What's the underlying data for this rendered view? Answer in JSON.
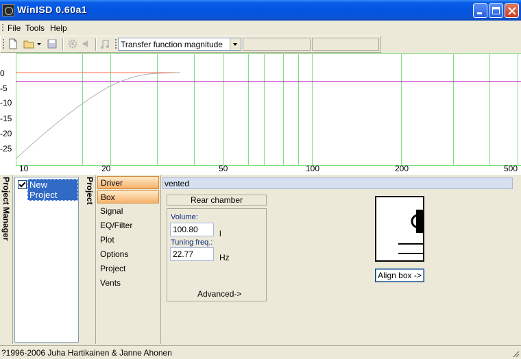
{
  "window": {
    "title": "WinISD 0.60a1"
  },
  "menu": {
    "items": [
      "File",
      "Tools",
      "Help"
    ]
  },
  "toolbar": {
    "icons": [
      "new-file-icon",
      "open-folder-icon",
      "dropdown-arrow-icon",
      "save-icon",
      "gear-icon",
      "speaker-icon",
      "music-note-icon"
    ],
    "plot_select": "Transfer function magnitude"
  },
  "graph": {
    "y_labels": [
      "0",
      "-5",
      "-10",
      "-15",
      "-20",
      "-25"
    ],
    "x_labels": [
      "10",
      "20",
      "50",
      "100",
      "200",
      "500"
    ],
    "series_colors": {
      "reference": "#ff6a4d",
      "limit": "#b100b1",
      "response": "#b0b0b0",
      "grid": "#7fe07f"
    }
  },
  "project_manager": {
    "label": "Project Manager",
    "tree": [
      {
        "name": "New Project",
        "checked": true
      }
    ]
  },
  "project_tab": {
    "label": "Project"
  },
  "nav": {
    "items": [
      "Driver",
      "Box",
      "Signal",
      "EQ/Filter",
      "Plot",
      "Options",
      "Project",
      "Vents"
    ],
    "highlighted": [
      "Driver",
      "Box"
    ]
  },
  "box_panel": {
    "header": "vented",
    "rear_chamber": "Rear chamber",
    "volume_label": "Volume:",
    "volume_value": "100.80",
    "volume_unit": "l",
    "tuning_label": "Tuning freq.:",
    "tuning_value": "22.77",
    "tuning_unit": "Hz",
    "advanced": "Advanced->",
    "align_button": "Align box ->"
  },
  "status": {
    "text": "?1996-2006 Juha Hartikainen & Janne Ahonen"
  }
}
